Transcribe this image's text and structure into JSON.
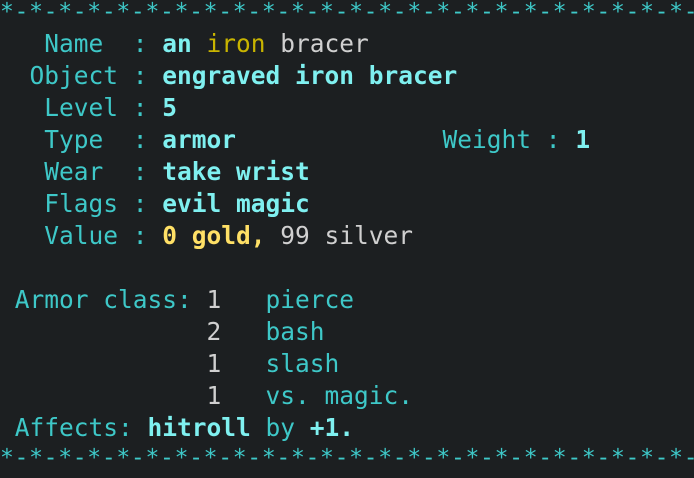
{
  "border": "*-*-*-*-*-*-*-*-*-*-*-*-*-*-*-*-*-*-*-*-*-*-*-*-*-*-*-*-*-*-*",
  "rows": [
    {
      "label": "   Name  : ",
      "parts": [
        {
          "t": "an ",
          "c": "bcyan"
        },
        {
          "t": "iron ",
          "c": "yellow"
        },
        {
          "t": "bracer",
          "c": "white"
        }
      ]
    },
    {
      "label": "  Object : ",
      "parts": [
        {
          "t": "engraved iron bracer",
          "c": "bcyan"
        }
      ]
    },
    {
      "label": "   Level : ",
      "parts": [
        {
          "t": "5",
          "c": "bcyan"
        }
      ]
    },
    {
      "label": "   Type  : ",
      "parts": [
        {
          "t": "armor",
          "c": "bcyan"
        },
        {
          "t": "              ",
          "c": "cyan"
        },
        {
          "t": "Weight : ",
          "c": "cyan"
        },
        {
          "t": "1",
          "c": "bcyan"
        }
      ]
    },
    {
      "label": "   Wear  : ",
      "parts": [
        {
          "t": "take wrist",
          "c": "bcyan"
        }
      ]
    },
    {
      "label": "   Flags : ",
      "parts": [
        {
          "t": "evil magic",
          "c": "bcyan"
        }
      ]
    },
    {
      "label": "   Value : ",
      "parts": [
        {
          "t": "0 gold,",
          "c": "byellow"
        },
        {
          "t": " 99 silver",
          "c": "white"
        }
      ]
    },
    {
      "label": "",
      "parts": []
    },
    {
      "label": " Armor class: ",
      "parts": [
        {
          "t": "1   ",
          "c": "white"
        },
        {
          "t": "pierce",
          "c": "cyan"
        }
      ]
    },
    {
      "label": "              ",
      "parts": [
        {
          "t": "2   ",
          "c": "white"
        },
        {
          "t": "bash",
          "c": "cyan"
        }
      ]
    },
    {
      "label": "              ",
      "parts": [
        {
          "t": "1   ",
          "c": "white"
        },
        {
          "t": "slash",
          "c": "cyan"
        }
      ]
    },
    {
      "label": "              ",
      "parts": [
        {
          "t": "1   ",
          "c": "white"
        },
        {
          "t": "vs. magic.",
          "c": "cyan"
        }
      ]
    },
    {
      "label": " Affects: ",
      "parts": [
        {
          "t": "hitroll",
          "c": "bcyan"
        },
        {
          "t": " by ",
          "c": "cyan"
        },
        {
          "t": "+1.",
          "c": "bcyan"
        }
      ]
    }
  ],
  "colors": {
    "background": "#1c1f21",
    "cyan": "#3ec8c8",
    "bright_cyan": "#7ff0f0",
    "yellow": "#c8b400",
    "bright_yellow": "#ffe066",
    "white": "#d0d0d0"
  }
}
